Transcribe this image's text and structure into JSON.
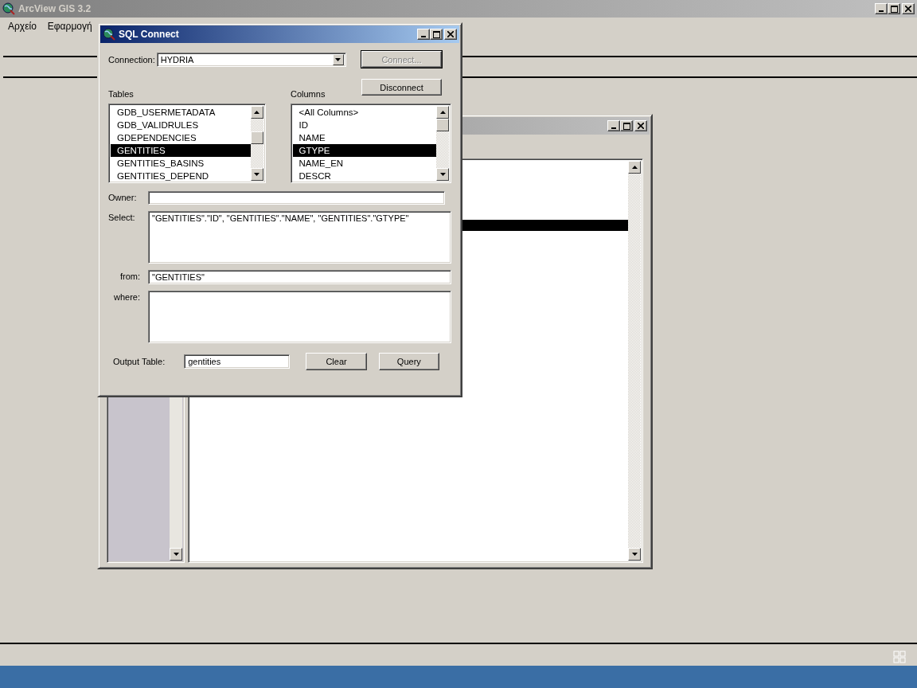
{
  "app_window": {
    "title": "ArcView GIS 3.2",
    "active": false
  },
  "menu": [
    {
      "label": "Αρχείο"
    },
    {
      "label": "Εφαρμογή"
    }
  ],
  "document_window": {
    "active": false
  },
  "dialog": {
    "title": "SQL Connect",
    "active": true,
    "connection_label": "Connection:",
    "connection": "HYDRIA",
    "buttons": [
      {
        "label": "Connect...",
        "disabled": true
      },
      {
        "label": "Disconnect",
        "disabled": false
      }
    ],
    "tables_label": "Tables",
    "tables": [
      {
        "label": "GDB_USERMETADATA",
        "selected": false
      },
      {
        "label": "GDB_VALIDRULES",
        "selected": false
      },
      {
        "label": "GDEPENDENCIES",
        "selected": false
      },
      {
        "label": "GENTITIES",
        "selected": true
      },
      {
        "label": "GENTITIES_BASINS",
        "selected": false
      },
      {
        "label": "GENTITIES_DEPEND",
        "selected": false
      }
    ],
    "columns_label": "Columns",
    "columns": [
      {
        "label": "<All Columns>",
        "selected": false
      },
      {
        "label": "ID",
        "selected": false
      },
      {
        "label": "NAME",
        "selected": false
      },
      {
        "label": "GTYPE",
        "selected": true
      },
      {
        "label": "NAME_EN",
        "selected": false
      },
      {
        "label": "DESCR",
        "selected": false
      }
    ],
    "owner_label": "Owner:",
    "select_label": "Select:",
    "select_value": "\"GENTITIES\".\"ID\", \"GENTITIES\".\"NAME\", \"GENTITIES\".\"GTYPE\"",
    "from_label": "from:",
    "from_value": "\"GENTITIES\"",
    "where_label": "where:",
    "output_label": "Output Table:",
    "output_value": "gentities",
    "actions": [
      {
        "label": "Clear"
      },
      {
        "label": "Query"
      }
    ]
  }
}
